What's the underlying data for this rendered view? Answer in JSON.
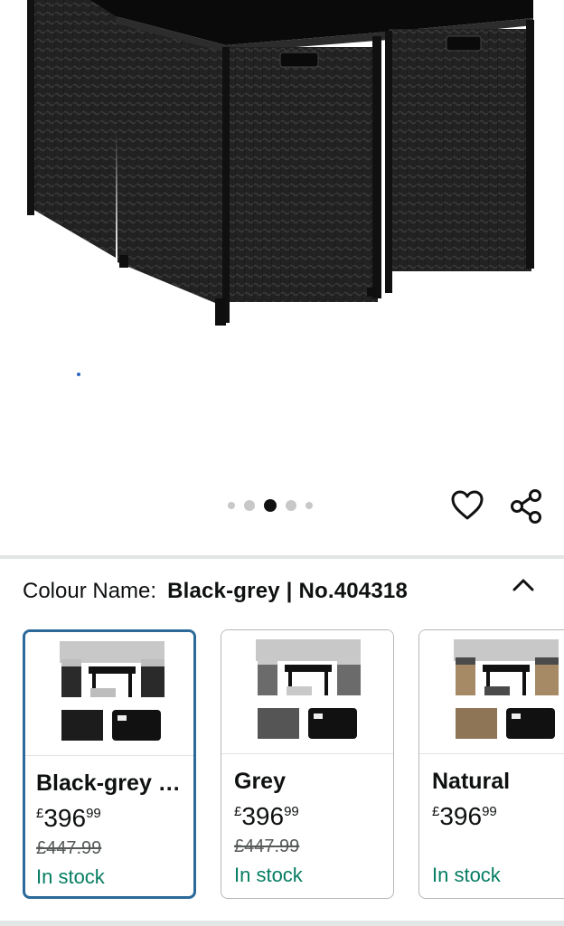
{
  "product_image": {
    "alt": "",
    "icon": "rattan-cube-furniture-image"
  },
  "carousel": {
    "count": 5,
    "active_index": 2
  },
  "actions": {
    "wishlist_icon": "heart-icon",
    "share_icon": "share-icon"
  },
  "colour": {
    "label": "Colour Name:",
    "value": "Black-grey | No.404318"
  },
  "swatches": [
    {
      "name": "Black-grey …",
      "currency": "£",
      "price_whole": "396",
      "price_fraction": "99",
      "was_price": "£447.99",
      "stock": "In stock",
      "selected": true,
      "tone": "black"
    },
    {
      "name": "Grey",
      "currency": "£",
      "price_whole": "396",
      "price_fraction": "99",
      "was_price": "£447.99",
      "stock": "In stock",
      "selected": false,
      "tone": "grey"
    },
    {
      "name": "Natural",
      "currency": "£",
      "price_whole": "396",
      "price_fraction": "99",
      "was_price": "",
      "stock": "In stock",
      "selected": false,
      "tone": "natural"
    }
  ],
  "colors": {
    "selected_border": "#2b6a9a",
    "in_stock": "#067d62",
    "muted": "#565959"
  }
}
